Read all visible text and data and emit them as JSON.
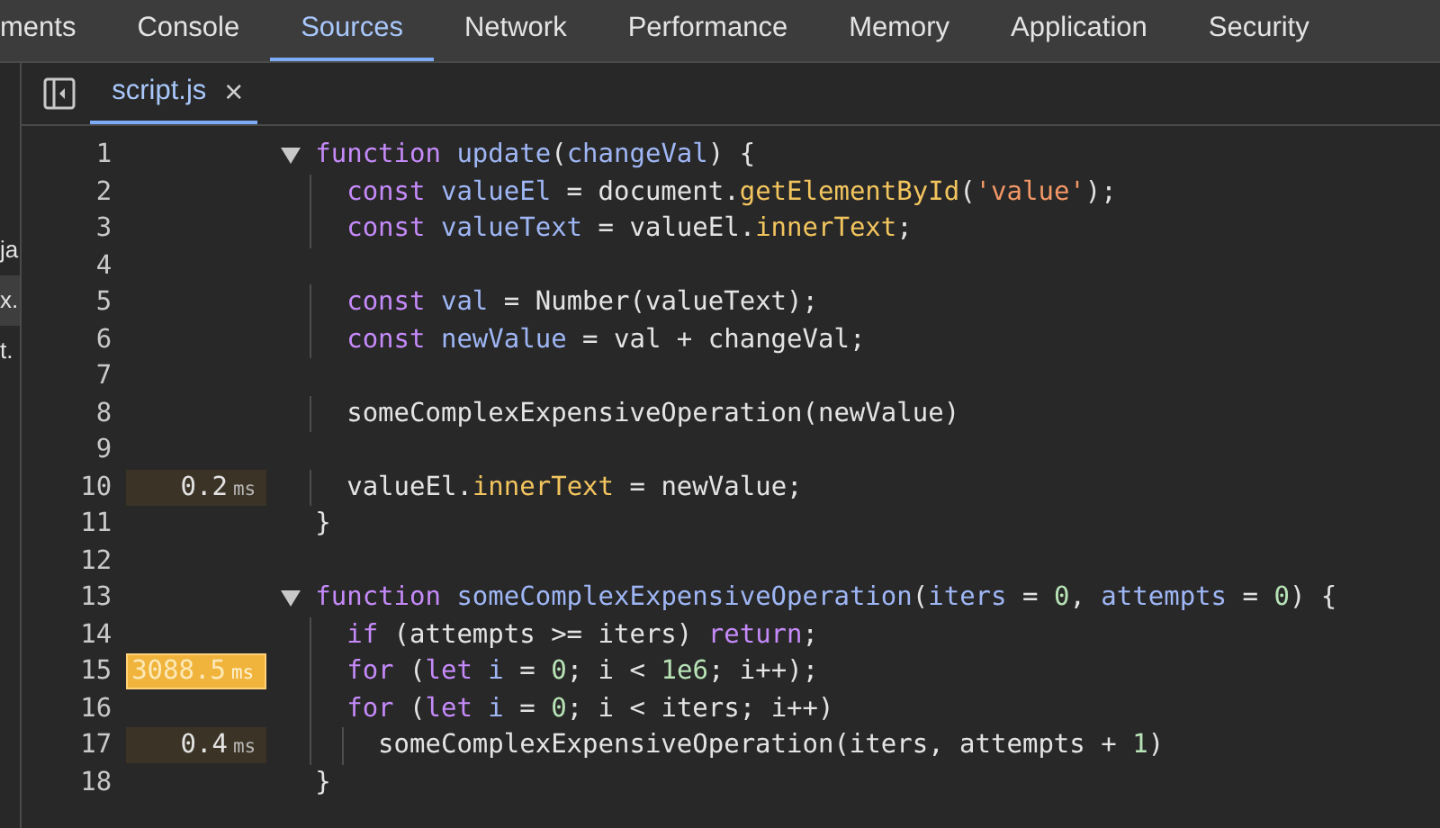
{
  "panel_tabs": [
    {
      "label": "ments",
      "selected": false
    },
    {
      "label": "Console",
      "selected": false
    },
    {
      "label": "Sources",
      "selected": true
    },
    {
      "label": "Network",
      "selected": false
    },
    {
      "label": "Performance",
      "selected": false
    },
    {
      "label": "Memory",
      "selected": false
    },
    {
      "label": "Application",
      "selected": false
    },
    {
      "label": "Security",
      "selected": false
    }
  ],
  "file_tree": [
    {
      "label": "ja",
      "selected": false
    },
    {
      "label": "x.",
      "selected": true
    },
    {
      "label": "t.",
      "selected": false
    }
  ],
  "file_tabs": [
    {
      "label": "script.js",
      "selected": true,
      "close": "×"
    }
  ],
  "code_lines": [
    {
      "number": "1",
      "expanded": true,
      "tokens": [
        {
          "kind": "keyword",
          "text": "function "
        },
        {
          "kind": "variable",
          "text": "update"
        },
        {
          "kind": "plain",
          "text": "("
        },
        {
          "kind": "variable",
          "text": "changeVal"
        },
        {
          "kind": "plain",
          "text": ") {"
        }
      ]
    },
    {
      "number": "2",
      "tokens": [
        {
          "kind": "keyword",
          "text": "  const "
        },
        {
          "kind": "variable",
          "text": "valueEl"
        },
        {
          "kind": "plain",
          "text": " = document."
        },
        {
          "kind": "method",
          "text": "getElementById"
        },
        {
          "kind": "plain",
          "text": "("
        },
        {
          "kind": "string",
          "text": "'value'"
        },
        {
          "kind": "plain",
          "text": ");"
        }
      ]
    },
    {
      "number": "3",
      "tokens": [
        {
          "kind": "keyword",
          "text": "  const "
        },
        {
          "kind": "variable",
          "text": "valueText"
        },
        {
          "kind": "plain",
          "text": " = valueEl."
        },
        {
          "kind": "method",
          "text": "innerText"
        },
        {
          "kind": "plain",
          "text": ";"
        }
      ]
    },
    {
      "number": "4"
    },
    {
      "number": "5",
      "tokens": [
        {
          "kind": "keyword",
          "text": "  const "
        },
        {
          "kind": "variable",
          "text": "val"
        },
        {
          "kind": "plain",
          "text": " = Number(valueText);"
        }
      ]
    },
    {
      "number": "6",
      "tokens": [
        {
          "kind": "keyword",
          "text": "  const "
        },
        {
          "kind": "variable",
          "text": "newValue"
        },
        {
          "kind": "plain",
          "text": " = val + changeVal;"
        }
      ]
    },
    {
      "number": "7"
    },
    {
      "number": "8",
      "tokens": [
        {
          "kind": "plain",
          "text": "  someComplexExpensiveOperation(newValue)"
        }
      ]
    },
    {
      "number": "9"
    },
    {
      "number": "10",
      "timing": {
        "value": "0.2",
        "unit": "ms",
        "hot": false
      },
      "tokens": [
        {
          "kind": "plain",
          "text": "  valueEl."
        },
        {
          "kind": "method",
          "text": "innerText"
        },
        {
          "kind": "plain",
          "text": " = newValue;"
        }
      ]
    },
    {
      "number": "11",
      "tokens": [
        {
          "kind": "plain",
          "text": "}"
        }
      ]
    },
    {
      "number": "12"
    },
    {
      "number": "13",
      "expanded": true,
      "tokens": [
        {
          "kind": "keyword",
          "text": "function "
        },
        {
          "kind": "variable",
          "text": "someComplexExpensiveOperation"
        },
        {
          "kind": "plain",
          "text": "("
        },
        {
          "kind": "variable",
          "text": "iters"
        },
        {
          "kind": "plain",
          "text": " = "
        },
        {
          "kind": "number",
          "text": "0"
        },
        {
          "kind": "plain",
          "text": ", "
        },
        {
          "kind": "variable",
          "text": "attempts"
        },
        {
          "kind": "plain",
          "text": " = "
        },
        {
          "kind": "number",
          "text": "0"
        },
        {
          "kind": "plain",
          "text": ") {"
        }
      ]
    },
    {
      "number": "14",
      "tokens": [
        {
          "kind": "keyword",
          "text": "  if"
        },
        {
          "kind": "plain",
          "text": " (attempts >= iters) "
        },
        {
          "kind": "keyword",
          "text": "return"
        },
        {
          "kind": "plain",
          "text": ";"
        }
      ]
    },
    {
      "number": "15",
      "timing": {
        "value": "3088.5",
        "unit": "ms",
        "hot": true
      },
      "tokens": [
        {
          "kind": "keyword",
          "text": "  for"
        },
        {
          "kind": "plain",
          "text": " ("
        },
        {
          "kind": "keyword",
          "text": "let "
        },
        {
          "kind": "variable",
          "text": "i"
        },
        {
          "kind": "plain",
          "text": " = "
        },
        {
          "kind": "number",
          "text": "0"
        },
        {
          "kind": "plain",
          "text": "; i < "
        },
        {
          "kind": "number",
          "text": "1e6"
        },
        {
          "kind": "plain",
          "text": "; i++);"
        }
      ]
    },
    {
      "number": "16",
      "tokens": [
        {
          "kind": "keyword",
          "text": "  for"
        },
        {
          "kind": "plain",
          "text": " ("
        },
        {
          "kind": "keyword",
          "text": "let "
        },
        {
          "kind": "variable",
          "text": "i"
        },
        {
          "kind": "plain",
          "text": " = "
        },
        {
          "kind": "number",
          "text": "0"
        },
        {
          "kind": "plain",
          "text": "; i < iters; i++)"
        }
      ]
    },
    {
      "number": "17",
      "timing": {
        "value": "0.4",
        "unit": "ms",
        "hot": false
      },
      "tokens": [
        {
          "kind": "plain",
          "text": "    someComplexExpensiveOperation(iters, attempts + "
        },
        {
          "kind": "number",
          "text": "1"
        },
        {
          "kind": "plain",
          "text": ")"
        }
      ]
    },
    {
      "number": "18",
      "tokens": [
        {
          "kind": "plain",
          "text": "}"
        }
      ]
    }
  ]
}
